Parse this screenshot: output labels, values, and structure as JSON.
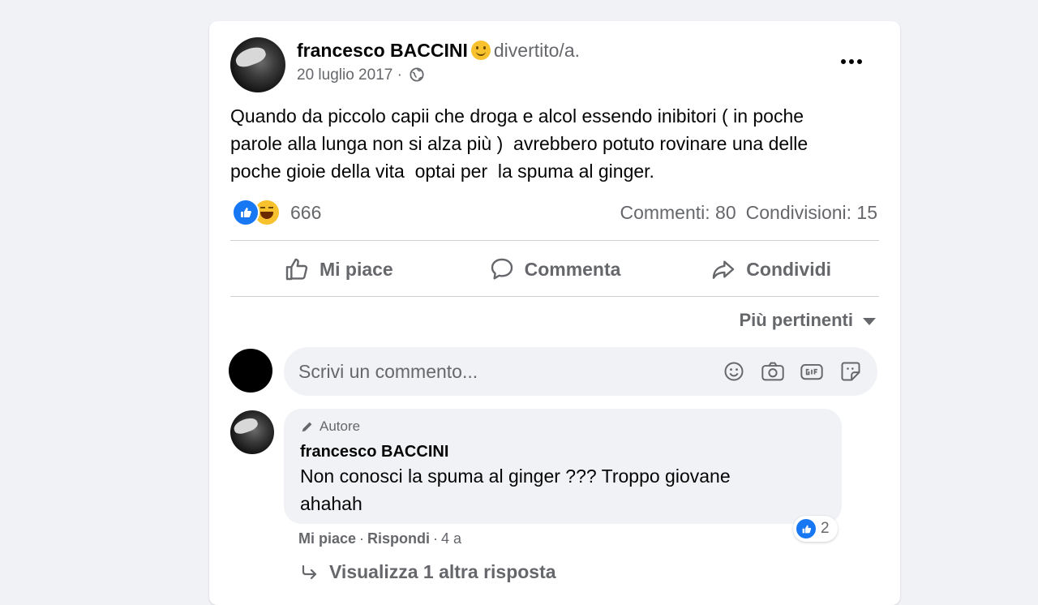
{
  "post": {
    "author": "francesco BACCINI",
    "feeling_icon": "smile-icon",
    "feeling": "divertito/a.",
    "date": "20 luglio 2017 ·",
    "text_lines": [
      "Quando da piccolo capii che droga e alcol essendo inibitori ( in poche",
      "parole alla lunga non si alza più )  avrebbero potuto rovinare una delle",
      "poche gioie della vita  optai per  la spuma al ginger."
    ],
    "reaction_count": "666",
    "comments": "Commenti: 80",
    "shares": "Condivisioni: 15"
  },
  "actions": {
    "like": "Mi piace",
    "comment": "Commenta",
    "share": "Condividi"
  },
  "sort": {
    "label": "Più pertinenti"
  },
  "comment_box": {
    "placeholder": "Scrivi un commento..."
  },
  "reply": {
    "badge": "Autore",
    "name": "francesco BACCINI",
    "text_line1": "Non conosci la spuma al ginger ??? Troppo giovane",
    "text_line2": "ahahah",
    "reactions": "2",
    "like": "Mi piace",
    "reply": "Rispondi",
    "time": "4 a",
    "sep": "·"
  },
  "view_more": "Visualizza 1 altra risposta",
  "colors": {
    "background": "#f0f2f5",
    "card": "#ffffff",
    "secondary_text": "#65676b",
    "like_blue": "#1877f2"
  }
}
